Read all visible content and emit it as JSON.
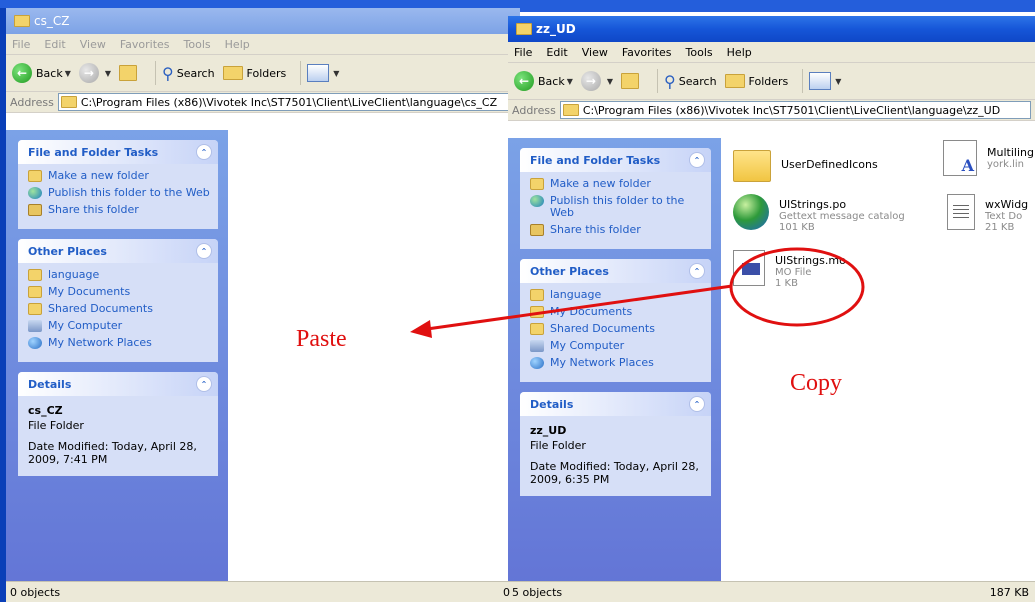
{
  "left_window": {
    "title": "cs_CZ",
    "menu": [
      "File",
      "Edit",
      "View",
      "Favorites",
      "Tools",
      "Help"
    ],
    "toolbar": {
      "back": "Back",
      "search": "Search",
      "folders": "Folders"
    },
    "address_label": "Address",
    "address": "C:\\Program Files (x86)\\Vivotek Inc\\ST7501\\Client\\LiveClient\\language\\cs_CZ",
    "tasks_header": "File and Folder Tasks",
    "tasks": [
      "Make a new folder",
      "Publish this folder to the Web",
      "Share this folder"
    ],
    "places_header": "Other Places",
    "places": [
      "language",
      "My Documents",
      "Shared Documents",
      "My Computer",
      "My Network Places"
    ],
    "details_header": "Details",
    "details": {
      "name": "cs_CZ",
      "type": "File Folder",
      "modified": "Date Modified: Today, April 28, 2009, 7:41 PM"
    },
    "status": "0 objects"
  },
  "right_window": {
    "title": "zz_UD",
    "menu": [
      "File",
      "Edit",
      "View",
      "Favorites",
      "Tools",
      "Help"
    ],
    "toolbar": {
      "back": "Back",
      "search": "Search",
      "folders": "Folders"
    },
    "address_label": "Address",
    "address": "C:\\Program Files (x86)\\Vivotek Inc\\ST7501\\Client\\LiveClient\\language\\zz_UD",
    "tasks_header": "File and Folder Tasks",
    "tasks": [
      "Make a new folder",
      "Publish this folder to the Web",
      "Share this folder"
    ],
    "places_header": "Other Places",
    "places": [
      "language",
      "My Documents",
      "Shared Documents",
      "My Computer",
      "My Network Places"
    ],
    "details_header": "Details",
    "details": {
      "name": "zz_UD",
      "type": "File Folder",
      "modified": "Date Modified: Today, April 28, 2009, 6:35 PM"
    },
    "files": [
      {
        "name": "UserDefinedIcons",
        "sub1": "",
        "sub2": "",
        "icon": "folder-icon"
      },
      {
        "name": "Multiling",
        "sub1": "york.lin",
        "sub2": "",
        "icon": "document-icon"
      },
      {
        "name": "UIStrings.po",
        "sub1": "Gettext message catalog",
        "sub2": "101 KB",
        "icon": "globe-icon"
      },
      {
        "name": "wxWidg",
        "sub1": "Text Do",
        "sub2": "21 KB",
        "icon": "text-file-icon"
      },
      {
        "name": "UIStrings.mo",
        "sub1": "MO File",
        "sub2": "1 KB",
        "icon": "mo-file-icon"
      }
    ],
    "status": "5 objects",
    "status_right": "187 KB"
  },
  "annotations": {
    "paste": "Paste",
    "copy": "Copy",
    "color": "#e01010"
  },
  "left_status_edge": "0"
}
